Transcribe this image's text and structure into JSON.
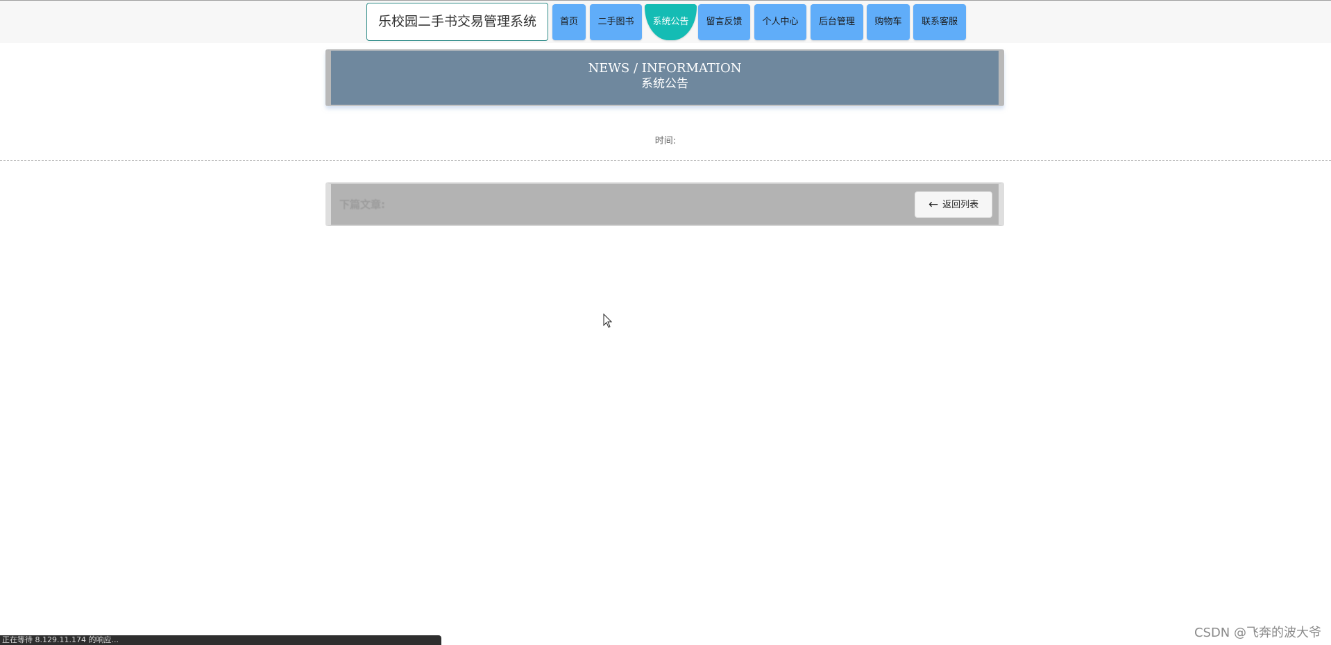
{
  "header": {
    "site_title": "乐校园二手书交易管理系统",
    "nav": [
      {
        "label": "首页",
        "active": false
      },
      {
        "label": "二手图书",
        "active": false
      },
      {
        "label": "系统公告",
        "active": true
      },
      {
        "label": "留言反馈",
        "active": false
      },
      {
        "label": "个人中心",
        "active": false
      },
      {
        "label": "后台管理",
        "active": false
      },
      {
        "label": "购物车",
        "active": false
      },
      {
        "label": "联系客服",
        "active": false
      }
    ]
  },
  "banner": {
    "title_en": "NEWS / INFORMATION",
    "title_cn": "系统公告"
  },
  "article": {
    "time_label": "时间:"
  },
  "navigation": {
    "prev_label": "下篇文章:",
    "back_label": "返回列表",
    "back_icon": "arrow-left-icon"
  },
  "status_bar": {
    "text": "正在等待 8.129.11.174 的响应..."
  },
  "watermark": {
    "text": "CSDN @飞奔的波大爷"
  },
  "colors": {
    "nav_button": "#60adf9",
    "nav_active": "#14bcb4",
    "banner_bg": "#6f889e",
    "title_border": "#2b8a86"
  }
}
